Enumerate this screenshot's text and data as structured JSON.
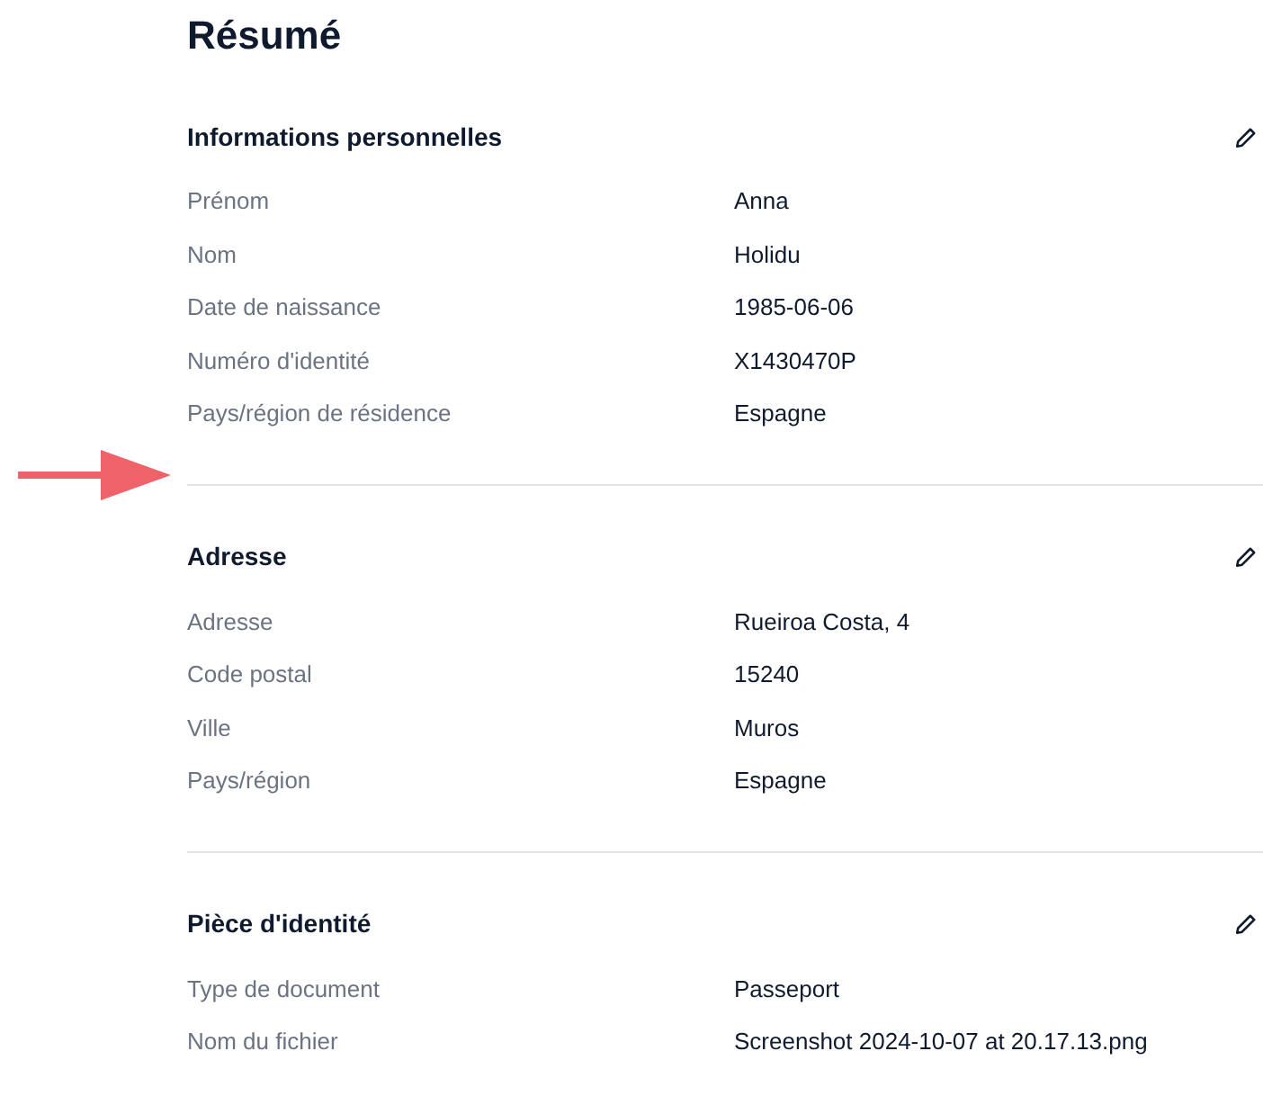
{
  "title": "Résumé",
  "sections": [
    {
      "heading": "Informations personnelles",
      "rows": [
        {
          "label": "Prénom",
          "value": "Anna"
        },
        {
          "label": "Nom",
          "value": "Holidu"
        },
        {
          "label": "Date de naissance",
          "value": "1985-06-06"
        },
        {
          "label": "Numéro d'identité",
          "value": "X1430470P"
        },
        {
          "label": "Pays/région de résidence",
          "value": "Espagne"
        }
      ]
    },
    {
      "heading": "Adresse",
      "rows": [
        {
          "label": "Adresse",
          "value": "Rueiroa Costa, 4"
        },
        {
          "label": "Code postal",
          "value": "15240"
        },
        {
          "label": "Ville",
          "value": "Muros"
        },
        {
          "label": "Pays/région",
          "value": "Espagne"
        }
      ]
    },
    {
      "heading": "Pièce d'identité",
      "rows": [
        {
          "label": "Type de document",
          "value": "Passeport"
        },
        {
          "label": "Nom du fichier",
          "value": "Screenshot 2024-10-07 at 20.17.13.png"
        }
      ]
    }
  ]
}
